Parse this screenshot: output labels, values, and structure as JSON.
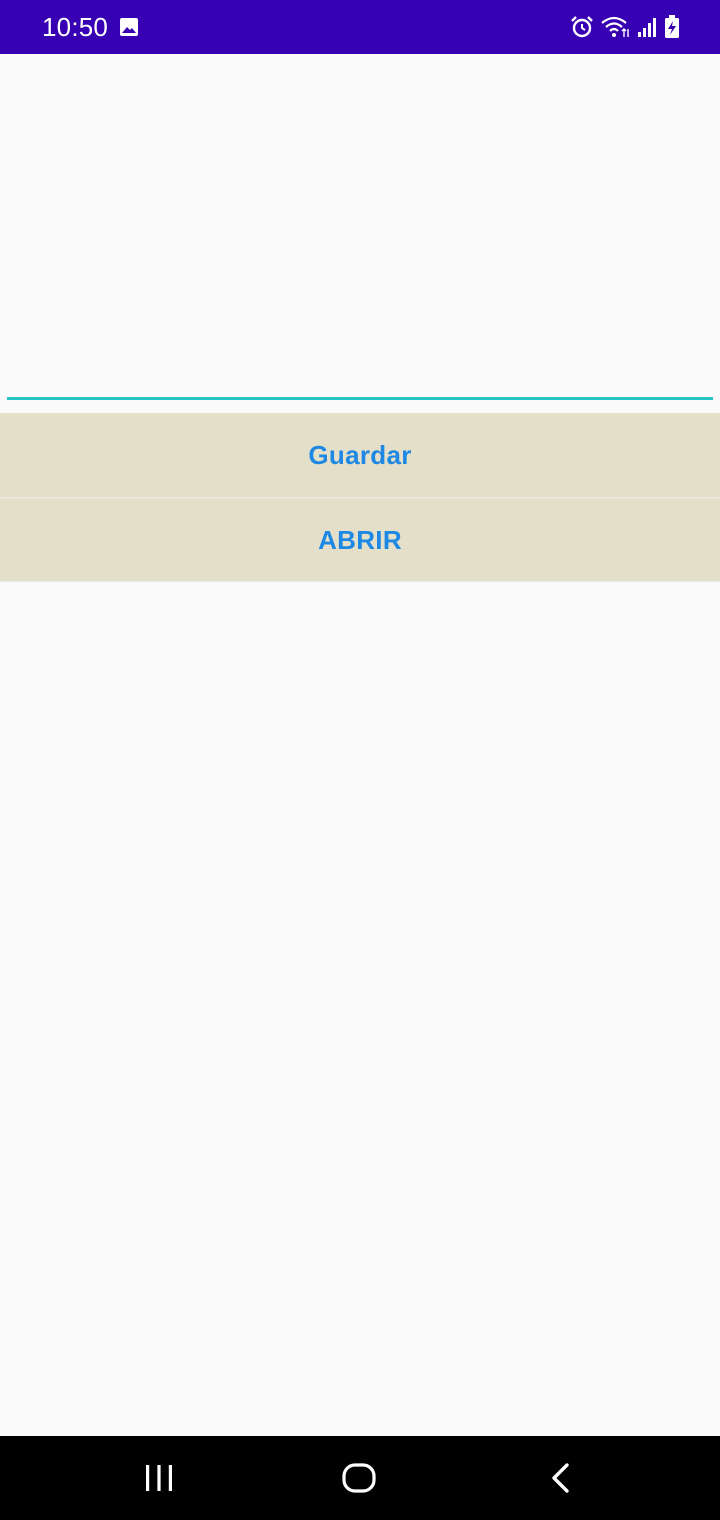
{
  "status_bar": {
    "time": "10:50",
    "icons": [
      "gallery-icon",
      "alarm-icon",
      "wifi-icon",
      "signal-icon",
      "battery-charging-icon"
    ]
  },
  "editor": {
    "text": "",
    "accent_color": "#26c6c6"
  },
  "buttons": {
    "save_label": "Guardar",
    "open_label": "ABRIR",
    "label_color": "#1e88e5",
    "background_color": "#e4dfc8"
  },
  "nav_bar": {
    "icons": [
      "recents-icon",
      "home-icon",
      "back-icon"
    ]
  },
  "colors": {
    "status_bar": "#3700b3",
    "background": "#fafafa",
    "nav_bar": "#000000"
  }
}
